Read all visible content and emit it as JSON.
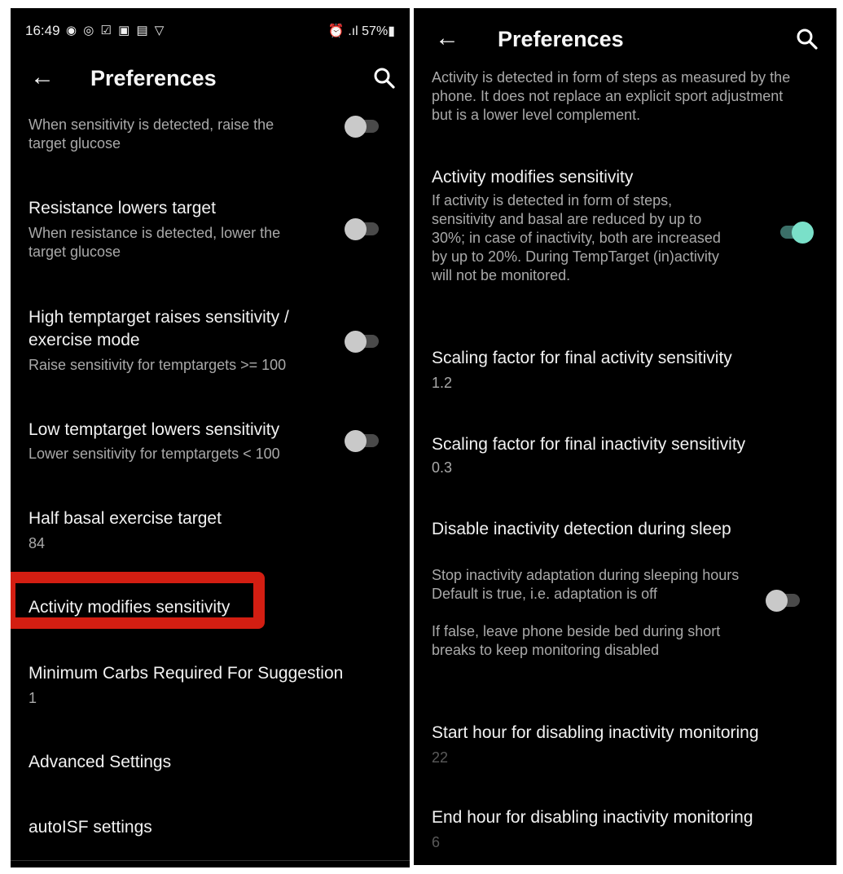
{
  "left": {
    "status": {
      "time": "16:49",
      "right": "57%",
      "icons_left": "◉ ◎ ☑ ▣ ▤ ▽",
      "icons_right": "⏰ .ıl"
    },
    "appbar": {
      "title": "Preferences"
    },
    "items": [
      {
        "title": "",
        "summary": "When sensitivity is detected, raise the target glucose",
        "toggle": false
      },
      {
        "title": "Resistance lowers target",
        "summary": "When resistance is detected, lower the target glucose",
        "toggle": false
      },
      {
        "title": "High temptarget raises sensitivity / exercise mode",
        "summary": "Raise sensitivity for temptargets >= 100",
        "toggle": false
      },
      {
        "title": "Low temptarget lowers sensitivity",
        "summary": "Lower sensitivity for temptargets < 100",
        "toggle": false
      },
      {
        "title": "Half basal exercise target",
        "summary": "84"
      },
      {
        "title": "Activity modifies sensitivity",
        "summary": ""
      },
      {
        "title": "Minimum Carbs Required For Suggestion",
        "summary": "1"
      },
      {
        "title": "Advanced Settings",
        "summary": ""
      },
      {
        "title": "autoISF settings",
        "summary": ""
      }
    ]
  },
  "right": {
    "appbar": {
      "title": "Preferences"
    },
    "intro": "Activity is detected in form of steps as measured by the phone. It does not replace an explicit sport adjustment but is a lower level complement.",
    "items": [
      {
        "title": "Activity modifies sensitivity",
        "summary": "If activity is detected in form of steps, sensitivity and basal are reduced by up to 30%; in case of inactivity, both are increased by up to 20%. During TempTarget (in)activity will not be monitored.",
        "toggle": true
      },
      {
        "title": "Scaling factor for final activity sensitivity",
        "summary": "1.2"
      },
      {
        "title": "Scaling factor for final inactivity sensitivity",
        "summary": "0.3"
      },
      {
        "title": "Disable inactivity detection during sleep",
        "summary": "Stop inactivity adaptation during sleeping hours\nDefault is true, i.e. adaptation is off\n\nIf false, leave phone beside bed during short breaks to keep monitoring disabled",
        "toggle": false
      },
      {
        "title": "Start hour for disabling inactivity monitoring",
        "summary": "22"
      },
      {
        "title": "End hour for disabling inactivity monitoring",
        "summary": "6"
      }
    ]
  },
  "colors": {
    "accent": "#7ae0c9",
    "highlight": "#d31e12"
  }
}
